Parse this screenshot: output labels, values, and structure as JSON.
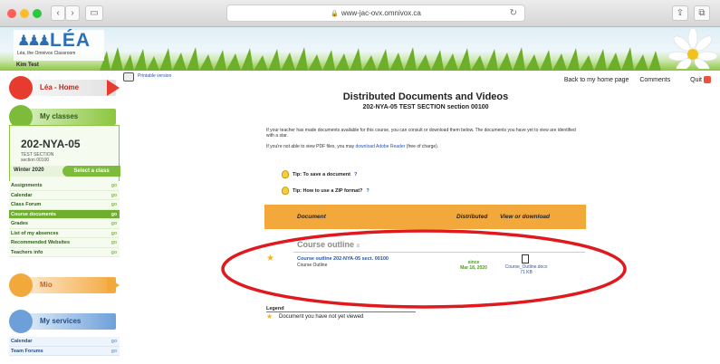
{
  "browser": {
    "url": "www-jac-ovx.omnivox.ca"
  },
  "banner": {
    "logo_text": "LÉA",
    "logo_sub": "Léa, the Omnivox Classroom",
    "user_name": "Kim Test"
  },
  "sidebar": {
    "home_tab": "Léa - Home",
    "classes_tab": "My classes",
    "class_code": "202-NYA-05",
    "class_sub1": "TEST SECTION",
    "class_sub2": "section 00100",
    "semester": "Winter 2020",
    "select_class": "Select a class",
    "menu": [
      {
        "label": "Assignments",
        "go": "go"
      },
      {
        "label": "Calendar",
        "go": "go"
      },
      {
        "label": "Class Forum",
        "go": "go"
      },
      {
        "label": "Course documents",
        "go": "go"
      },
      {
        "label": "Grades",
        "go": "go"
      },
      {
        "label": "List of my absences",
        "go": "go"
      },
      {
        "label": "Recommended Websites",
        "go": "go"
      },
      {
        "label": "Teachers info",
        "go": "go"
      }
    ],
    "mio_tab": "Mio",
    "services_tab": "My services",
    "services_menu": [
      {
        "label": "Calendar",
        "go": "go"
      },
      {
        "label": "Team Forums",
        "go": "go"
      }
    ]
  },
  "header": {
    "printable": "Printable version",
    "back_home": "Back to my home page",
    "comments": "Comments",
    "quit": "Quit"
  },
  "main": {
    "title": "Distributed Documents and Videos",
    "subtitle": "202-NYA-05 TEST SECTION section 00100",
    "intro": "If your teacher has made documents available for this course, you can consult or download them below.  The documents you have yet to view are identified with a star.",
    "pdf_note_prefix": "If you're not able to view PDF files, you may ",
    "pdf_note_link": "download Adobe Reader",
    "pdf_note_suffix": " (free of charge).",
    "tips": [
      {
        "label": "Tip: To save a document",
        "q": "?"
      },
      {
        "label": "Tip: How to use a ZIP format?",
        "q": "?"
      }
    ],
    "table_headers": {
      "document": "Document",
      "distributed": "Distributed",
      "view": "View or download"
    },
    "section_title": "Course outline",
    "section_title_mark": "≡",
    "document": {
      "title": "Course outline 202-NYA-05 sect. 00100",
      "subtitle": "Course Outline",
      "since_label": "since",
      "since_date": "Mar 18, 2020",
      "file_name": "Course_Outline.docx",
      "file_size": "71 KB"
    },
    "legend_title": "Legend",
    "legend_text": "Document you have not yet viewed"
  },
  "colors": {
    "accent_green": "#7dbb3a",
    "orange_header": "#f3a83c",
    "annotation_red": "#e0191e",
    "link_blue": "#2b54a8"
  }
}
